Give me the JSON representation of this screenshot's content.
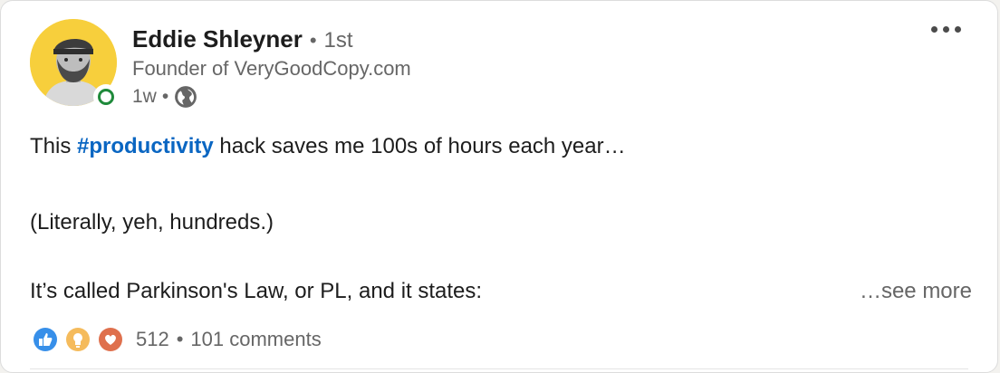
{
  "author": {
    "name": "Eddie Shleyner",
    "connection_degree": "1st",
    "headline": "Founder of VeryGoodCopy.com",
    "time_ago": "1w",
    "visibility_icon": "globe-icon"
  },
  "post": {
    "text_before_hashtag": "This ",
    "hashtag": "#productivity",
    "text_after_hashtag": " hack saves me 100s of hours each year…",
    "paragraph2": "(Literally, yeh, hundreds.)",
    "paragraph3": "It’s called Parkinson's Law, or PL, and it states:",
    "see_more": "…see more"
  },
  "social": {
    "reaction_icons": [
      "like-icon",
      "insightful-icon",
      "love-icon"
    ],
    "reaction_count": "512",
    "comments": "101 comments"
  },
  "colors": {
    "accent": "#0a66c2",
    "avatar_bg": "#f7cf3c",
    "presence": "#1f8a3b"
  }
}
